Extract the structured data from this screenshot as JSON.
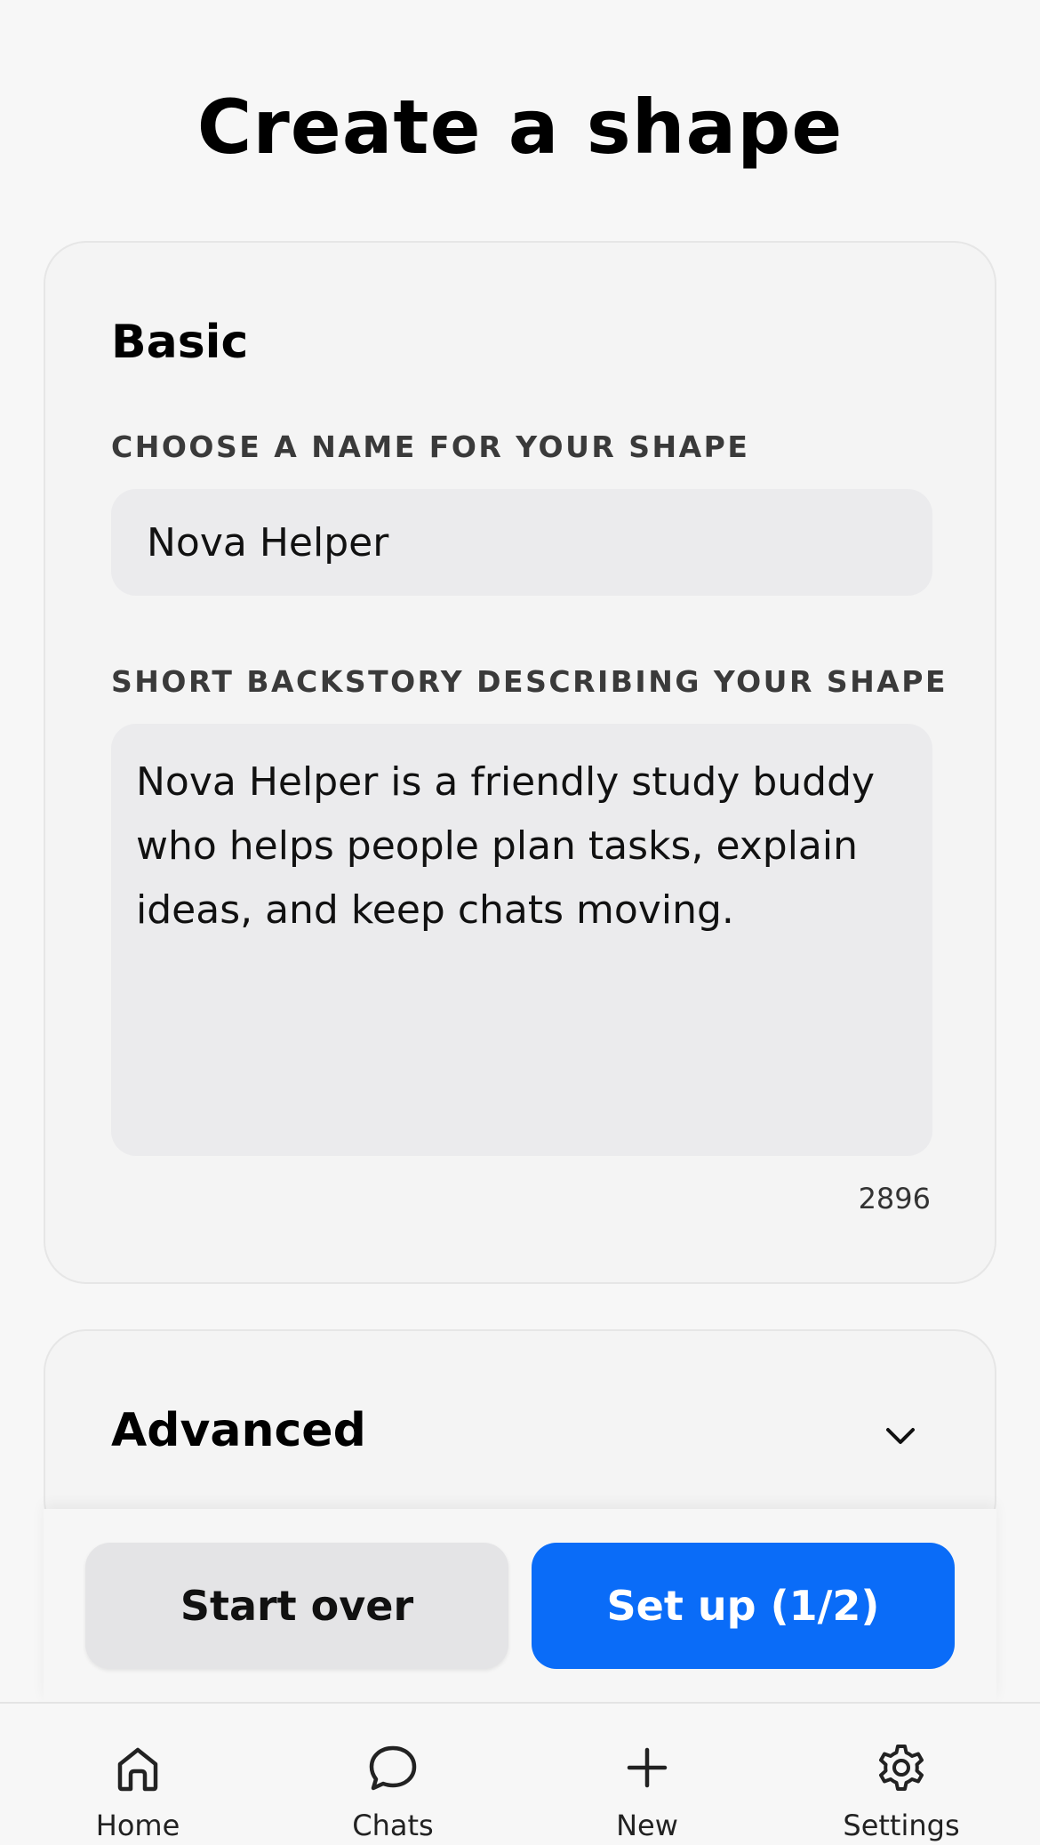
{
  "page": {
    "title": "Create a shape"
  },
  "basic": {
    "section_title": "Basic",
    "name_label": "CHOOSE A NAME FOR YOUR SHAPE",
    "name_value": "Nova Helper",
    "backstory_label": "SHORT BACKSTORY DESCRIBING YOUR SHAPE",
    "backstory_value": "Nova Helper is a friendly study buddy who helps people plan tasks, explain ideas, and keep chats moving.",
    "char_count": "2896"
  },
  "advanced": {
    "section_title": "Advanced",
    "expand_icon": "chevron-down-icon"
  },
  "actions": {
    "start_over_label": "Start over",
    "setup_label": "Set up (1/2)",
    "primary_color": "#0a6cf8"
  },
  "tabs": [
    {
      "label": "Home",
      "icon": "home-icon"
    },
    {
      "label": "Chats",
      "icon": "chat-bubble-icon"
    },
    {
      "label": "New",
      "icon": "plus-icon"
    },
    {
      "label": "Settings",
      "icon": "gear-icon"
    }
  ]
}
